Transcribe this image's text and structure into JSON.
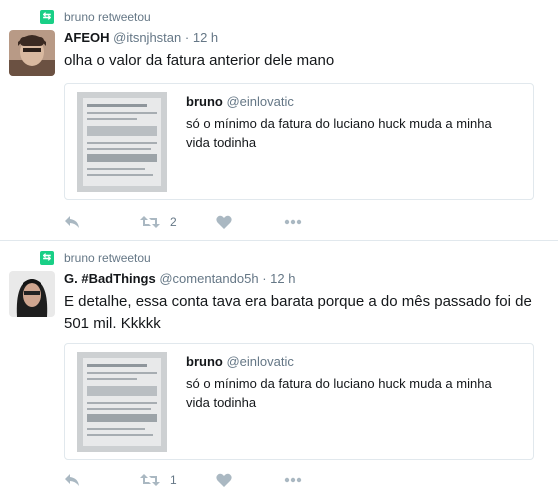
{
  "tweets": [
    {
      "retweeted_by": "bruno retweetou",
      "name": "AFEOH",
      "handle": "@itsnjhstan",
      "dot": "·",
      "time": "12 h",
      "text": "olha o valor da fatura anterior dele mano",
      "quote": {
        "name": "bruno",
        "handle": "@einlovatic",
        "text": "só o mínimo da fatura do luciano huck muda a minha vida todinha"
      },
      "retweet_count": "2"
    },
    {
      "retweeted_by": "bruno retweetou",
      "name": "G. #BadThings",
      "handle": "@comentando5h",
      "dot": "·",
      "time": "12 h",
      "text": "E detalhe, essa conta tava era barata porque a do mês passado foi de 501 mil. Kkkkk",
      "quote": {
        "name": "bruno",
        "handle": "@einlovatic",
        "text": "só o mínimo da fatura do luciano huck muda a minha vida todinha"
      },
      "retweet_count": "1"
    }
  ],
  "colors": {
    "retweet_green": "#19cf86",
    "secondary_text": "#657786",
    "icon_gray": "#aab8c2",
    "border": "#e1e8ed"
  },
  "icons": [
    "retweet-badge-icon",
    "reply-icon",
    "retweet-icon",
    "like-icon",
    "more-icon"
  ]
}
